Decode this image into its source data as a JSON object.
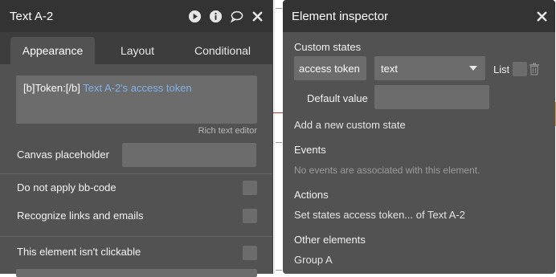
{
  "property_editor": {
    "title": "Text A-2",
    "tabs": [
      {
        "label": "Appearance",
        "active": true
      },
      {
        "label": "Layout",
        "active": false
      },
      {
        "label": "Conditional",
        "active": false
      }
    ],
    "rich_text": {
      "code_prefix": "[b]Token:[/b]",
      "dynamic_expression": "Text A-2's access token",
      "editor_label": "Rich text editor"
    },
    "canvas_placeholder_label": "Canvas placeholder",
    "canvas_placeholder_value": "",
    "options": [
      {
        "label": "Do not apply bb-code",
        "checked": false
      },
      {
        "label": "Recognize links and emails",
        "checked": false
      },
      {
        "label": "This element isn't clickable",
        "checked": false
      }
    ]
  },
  "inspector": {
    "title": "Element inspector",
    "custom_states_heading": "Custom states",
    "state_name": "access token",
    "state_type": "text",
    "list_label": "List",
    "default_value_label": "Default value",
    "default_value": "",
    "add_state_label": "Add a new custom state",
    "events_heading": "Events",
    "events_empty": "No events are associated with this element.",
    "actions_heading": "Actions",
    "action_item": "Set states access token... of Text A-2",
    "other_elements_heading": "Other elements",
    "other_element_item": "Group A"
  },
  "colors": {
    "panel_bg": "#525252",
    "header_bg": "#333333",
    "field_bg": "#6c6c6c",
    "dynamic_text": "#7fb2ea"
  },
  "icons": [
    "play-icon",
    "info-icon",
    "comment-icon",
    "close-icon",
    "chevron-down-icon",
    "trash-icon"
  ]
}
